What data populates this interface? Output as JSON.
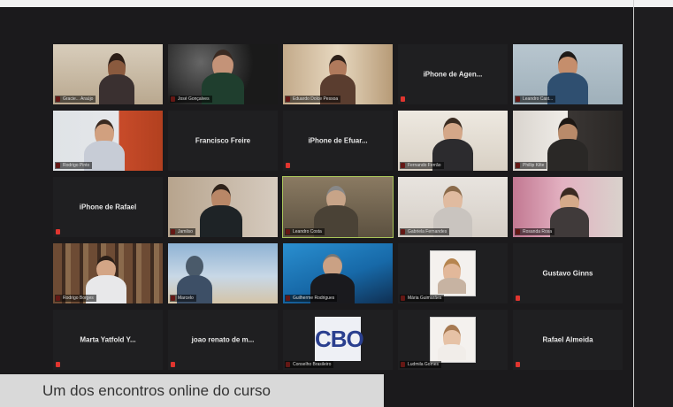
{
  "caption": "Um dos encontros online do curso",
  "tiles": [
    {
      "label": "Gracie... Araújo",
      "type": "video"
    },
    {
      "label": "José Gonçalves",
      "type": "video"
    },
    {
      "label": "Eduardo Dolce Pessoa",
      "type": "video"
    },
    {
      "name": "iPhone de Agen...",
      "label": "",
      "type": "name"
    },
    {
      "label": "Leandro Cast...",
      "type": "video"
    },
    {
      "label": "Rodrigo Pinto",
      "type": "video"
    },
    {
      "name": "Francisco Freire",
      "label": "",
      "type": "name"
    },
    {
      "name": "iPhone de Efuar...",
      "label": "",
      "type": "name"
    },
    {
      "label": "Fernando Ferrão",
      "type": "video"
    },
    {
      "label": "Phillip Kilte",
      "type": "video"
    },
    {
      "name": "iPhone de Rafael",
      "label": "",
      "type": "name"
    },
    {
      "label": "Jamilso",
      "type": "video"
    },
    {
      "label": "Leandro Costa",
      "type": "video"
    },
    {
      "label": "Gabriela Fernandes",
      "type": "video"
    },
    {
      "label": "Rosanda Rosa",
      "type": "video"
    },
    {
      "label": "Rodrigo Borges",
      "type": "video"
    },
    {
      "label": "Marcelo",
      "type": "video"
    },
    {
      "label": "Guilherme Rodrigues",
      "type": "video"
    },
    {
      "label": "Mária Guimarães",
      "type": "photo"
    },
    {
      "name": "Gustavo Ginns",
      "label": "",
      "type": "name"
    },
    {
      "name": "Marta Yatfold Y...",
      "label": "",
      "type": "name"
    },
    {
      "name": "joao renato de m...",
      "label": "",
      "type": "name"
    },
    {
      "label": "Conselho Brasileiro",
      "type": "cbo",
      "logo_text": "CBO"
    },
    {
      "label": "Ludmila Gomes",
      "type": "photo"
    },
    {
      "name": "Rafael Almeida",
      "label": "",
      "type": "name"
    }
  ],
  "colors": {
    "active_border": "#a9c55a",
    "mic_muted": "#e0352f",
    "tile_bg": "#1e1e1e"
  }
}
